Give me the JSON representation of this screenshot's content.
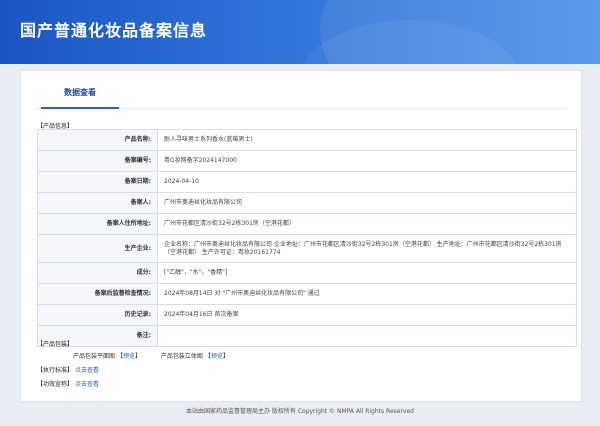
{
  "header": {
    "title": "国产普通化妆品备案信息"
  },
  "tabs": [
    {
      "label": "数据查看"
    }
  ],
  "product_info": {
    "section_label": "【产品信息】",
    "rows": [
      {
        "label": "产品名称:",
        "value": "耐人寻味男士系列香水(蓝莓男士)"
      },
      {
        "label": "备案编号:",
        "value": "粤G妆网备字2024147000"
      },
      {
        "label": "备案日期:",
        "value": "2024-04-10"
      },
      {
        "label": "备案人:",
        "value": "广州市奥迪丝化妆品有限公司"
      },
      {
        "label": "备案人住所地址:",
        "value": "广州市花都区清沙街32号2栋301房（空港花都）"
      },
      {
        "label": "生产企业:",
        "value": "企业名称：广州市奥迪丝化妆品有限公司 企业地址：广州市花都区清沙街32号2栋301房（空港花都） 生产地址：广州市花都区清沙街32号2栋301房（空港花都） 生产许可证：粤妆20161774"
      },
      {
        "label": "成分:",
        "value": "[\"乙醇\"，\"水\"，\"香精\"]"
      },
      {
        "label": "备案后监督检查情况:",
        "value": "2024年08月14日 对 \"广州市奥迪丝化妆品有限公司\" 通过"
      },
      {
        "label": "历史记录:",
        "value": "2024年04月16日 首次备案"
      },
      {
        "label": "备注:",
        "value": ""
      }
    ]
  },
  "packaging": {
    "section_label": "【产品包装】",
    "items": [
      {
        "label": "产品包装平面图",
        "link": "预览"
      },
      {
        "label": "产品包装立体图",
        "link": "预览"
      }
    ]
  },
  "standard": {
    "section_label": "【执行标准】",
    "link": "点击查看"
  },
  "efficacy": {
    "section_label": "【功效宣称】",
    "link": "点击查看"
  },
  "footer": {
    "text": "本站由国家药品监督管理局主办 版权所有 Copyright © NMPA All Rights Reserved"
  }
}
